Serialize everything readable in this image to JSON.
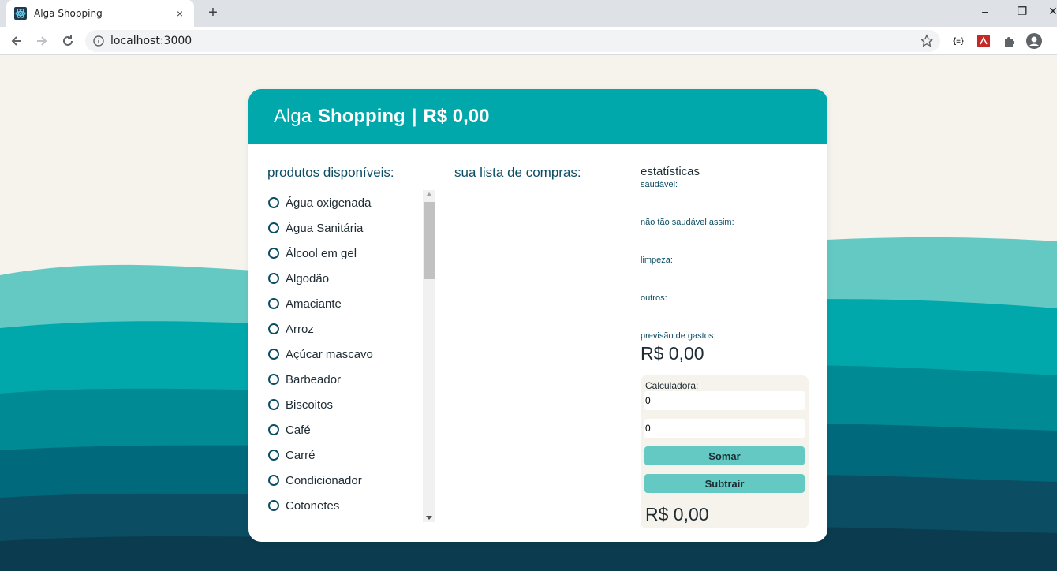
{
  "browser": {
    "tab_title": "Alga Shopping",
    "tab_close": "×",
    "new_tab": "+",
    "url": "localhost:3000",
    "window_controls": [
      "–",
      "❐",
      "✕"
    ],
    "extensions": [
      "{≡}",
      "",
      "",
      ""
    ]
  },
  "header": {
    "brand_light": "Alga",
    "brand_bold": "Shopping",
    "separator": "|",
    "total": "R$ 0,00",
    "color": "#00a8ab"
  },
  "products": {
    "title": "produtos disponíveis:",
    "items": [
      "Água oxigenada",
      "Água Sanitária",
      "Álcool em gel",
      "Algodão",
      "Amaciante",
      "Arroz",
      "Açúcar mascavo",
      "Barbeador",
      "Biscoitos",
      "Café",
      "Carré",
      "Condicionador",
      "Cotonetes"
    ]
  },
  "shopping_list": {
    "title": "sua lista de compras:"
  },
  "stats": {
    "title": "estatísticas",
    "healthy": "saudável:",
    "not_healthy": "não tão saudável assim:",
    "cleaning": "limpeza:",
    "others": "outros:",
    "forecast_label": "previsão de gastos:",
    "forecast_value": "R$ 0,00"
  },
  "calculator": {
    "label": "Calculadora:",
    "input_a": "0",
    "input_b": "0",
    "add_label": "Somar",
    "subtract_label": "Subtrair",
    "result": "R$ 0,00"
  }
}
